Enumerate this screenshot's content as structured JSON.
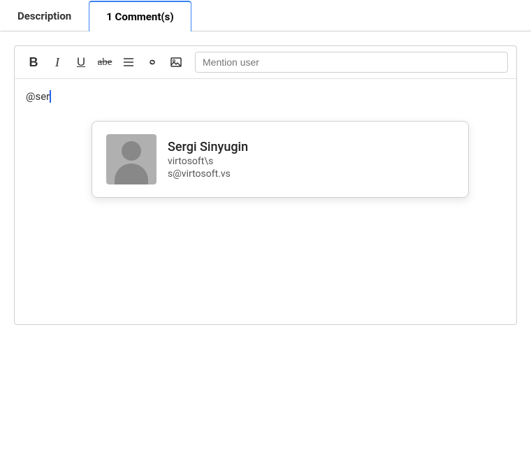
{
  "tabs": [
    {
      "id": "description",
      "label": "Description",
      "active": false
    },
    {
      "id": "comments",
      "label": "1 Comment(s)",
      "active": true
    }
  ],
  "toolbar": {
    "bold_label": "B",
    "italic_label": "I",
    "underline_label": "U",
    "strikethrough_label": "abe",
    "list_icon": "≡",
    "mention_placeholder": "Mention user"
  },
  "editor": {
    "content": "@ser"
  },
  "mention_dropdown": {
    "user": {
      "name": "Sergi Sinyugin",
      "domain": "virtosoft\\s",
      "email": "s@virtosoft.vs"
    }
  }
}
